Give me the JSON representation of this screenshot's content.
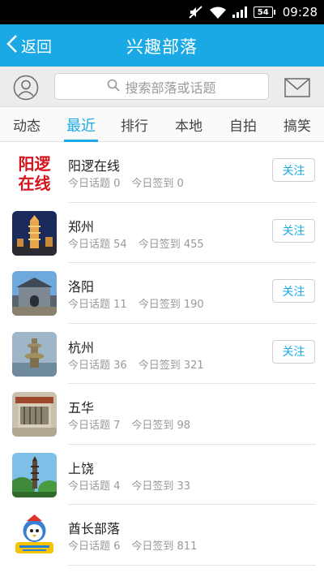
{
  "status_bar": {
    "time": "09:28",
    "battery": "54",
    "icons": [
      "mute-icon",
      "wifi-icon",
      "signal-icon",
      "battery-icon"
    ]
  },
  "header": {
    "back_label": "返回",
    "title": "兴趣部落"
  },
  "search": {
    "placeholder": "搜索部落或话题"
  },
  "tabs": [
    {
      "label": "动态",
      "active": false
    },
    {
      "label": "最近",
      "active": true
    },
    {
      "label": "排行",
      "active": false
    },
    {
      "label": "本地",
      "active": false
    },
    {
      "label": "自拍",
      "active": false
    },
    {
      "label": "搞笑",
      "active": false
    }
  ],
  "list": [
    {
      "name": "阳逻在线",
      "topics": "今日话题 0",
      "signins": "今日签到 0",
      "follow": "关注",
      "thumb_text": [
        "阳逻",
        "在线"
      ]
    },
    {
      "name": "郑州",
      "topics": "今日话题 54",
      "signins": "今日签到 455",
      "follow": "关注"
    },
    {
      "name": "洛阳",
      "topics": "今日话题 11",
      "signins": "今日签到 190",
      "follow": "关注"
    },
    {
      "name": "杭州",
      "topics": "今日话题 36",
      "signins": "今日签到 321",
      "follow": "关注"
    },
    {
      "name": "五华",
      "topics": "今日话题 7",
      "signins": "今日签到 98"
    },
    {
      "name": "上饶",
      "topics": "今日话题 4",
      "signins": "今日签到 33"
    },
    {
      "name": "酋长部落",
      "topics": "今日话题 6",
      "signins": "今日签到 811"
    }
  ],
  "colors": {
    "accent": "#1ba9e6",
    "title_bar": "#1ba9e6",
    "subtle_text": "#999999"
  }
}
